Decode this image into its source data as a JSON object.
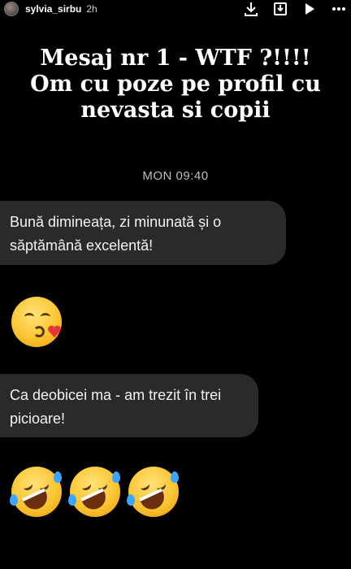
{
  "story": {
    "username": "sylvia_sirbu",
    "time_ago": "2h"
  },
  "icons": [
    "download-icon",
    "save-icon",
    "play-icon",
    "more-icon"
  ],
  "header": {
    "line1": "Mesaj nr 1 - WTF ?!!!!",
    "line2": "Om cu poze pe profil cu",
    "line3": "nevasta si copii"
  },
  "chat": {
    "timestamp": "MON 09:40",
    "messages": [
      "Bună dimineața, zi minunată și o săptămână excelentă!",
      "Ca deobicei ma - am trezit în trei picioare!"
    ]
  },
  "emojis": {
    "kiss": "face-blowing-kiss",
    "laugh": [
      "rolling-on-floor-laughing",
      "rolling-on-floor-laughing",
      "rolling-on-floor-laughing"
    ]
  },
  "colors": {
    "background": "#000000",
    "bubble": "#2a2a2a",
    "timestamp": "#bdbdbd"
  }
}
